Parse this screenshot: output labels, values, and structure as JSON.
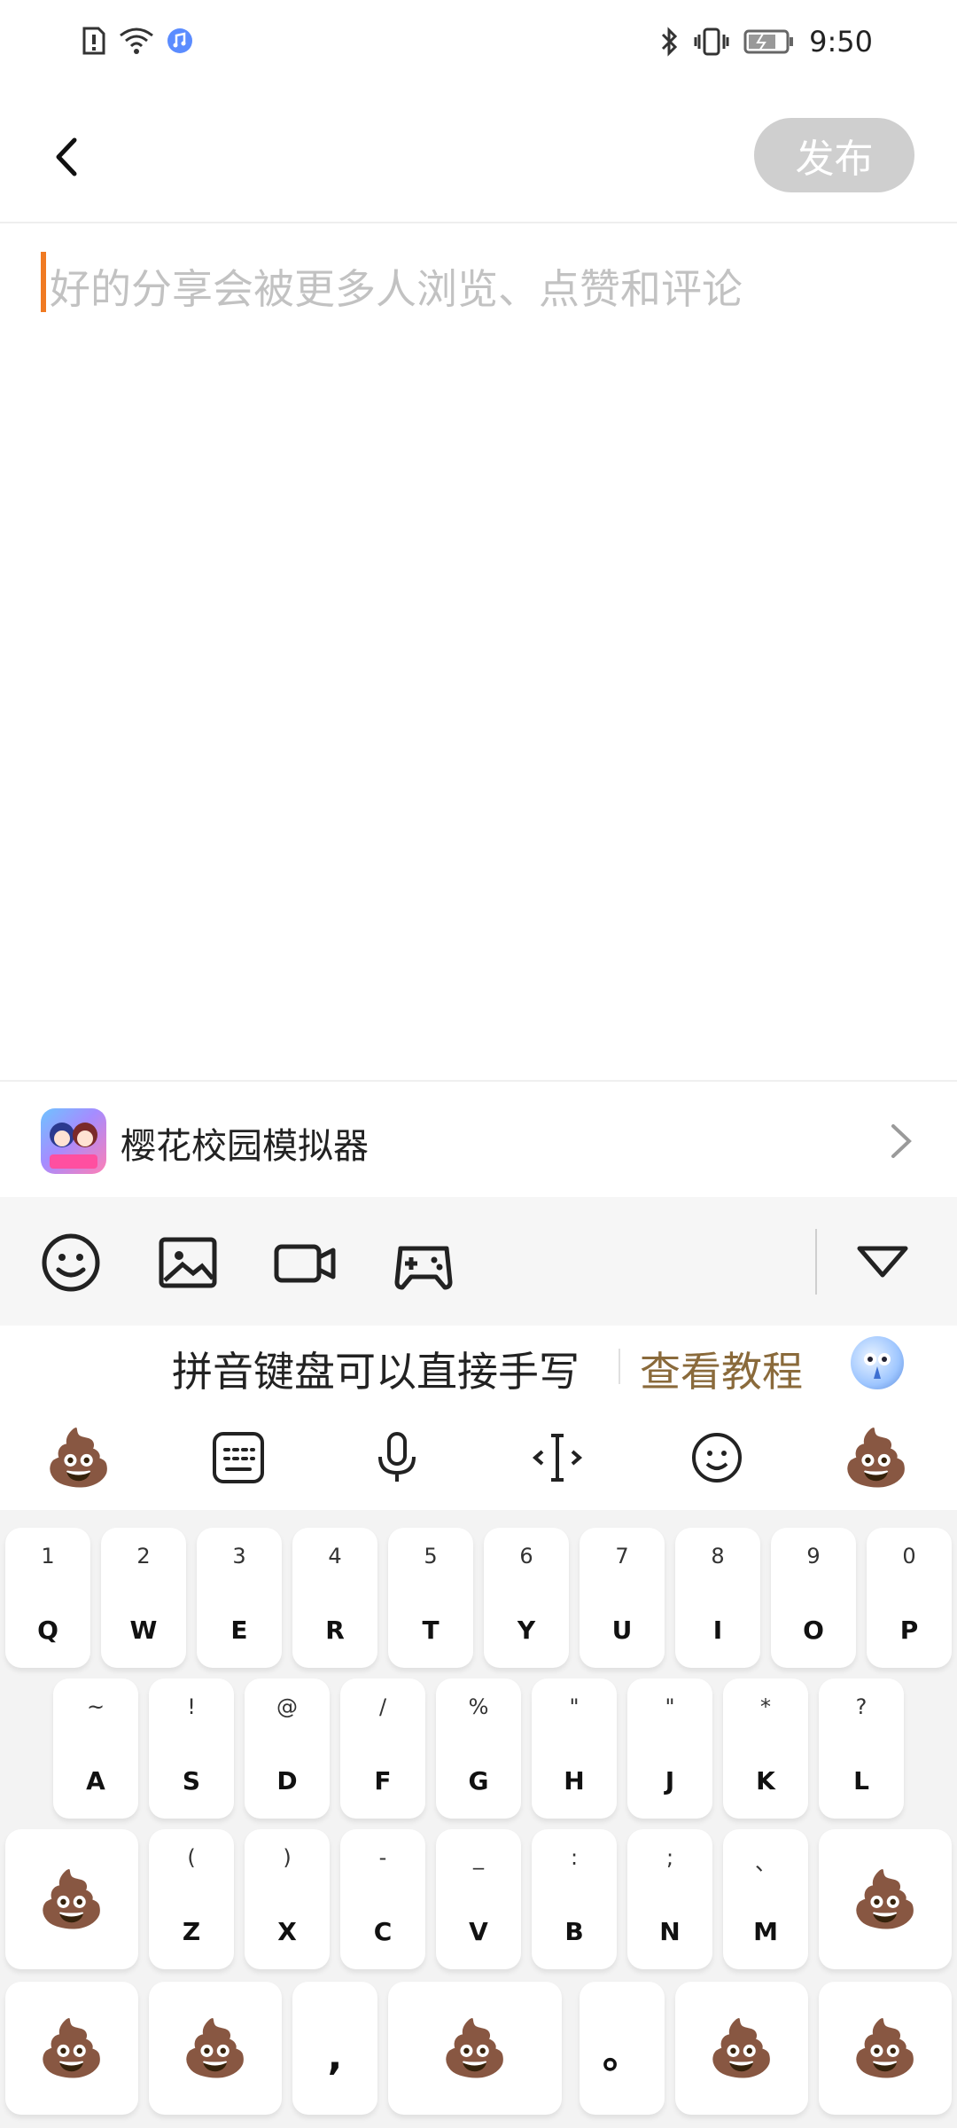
{
  "status_bar": {
    "time": "9:50",
    "left_icons": [
      "sim-alert-icon",
      "wifi-icon",
      "music-app-icon"
    ],
    "right_icons": [
      "bluetooth-icon",
      "vibrate-icon",
      "battery-icon"
    ]
  },
  "topbar": {
    "publish_label": "发布"
  },
  "editor": {
    "placeholder": "好的分享会被更多人浏览、点赞和评论"
  },
  "game": {
    "name": "樱花校园模拟器"
  },
  "toolbar": {
    "tools": [
      "emoji-icon",
      "image-icon",
      "video-icon",
      "gamepad-icon"
    ],
    "collapse_icon": "triangle-down-icon"
  },
  "keyboard": {
    "hint_text": "拼音键盘可以直接手写",
    "hint_link": "查看教程",
    "function_keys": [
      "poop-emoji",
      "keyboard-icon",
      "microphone-icon",
      "cursor-icon",
      "smile-icon",
      "poop-emoji"
    ],
    "row1": [
      {
        "main": "Q",
        "sub": "1"
      },
      {
        "main": "W",
        "sub": "2"
      },
      {
        "main": "E",
        "sub": "3"
      },
      {
        "main": "R",
        "sub": "4"
      },
      {
        "main": "T",
        "sub": "5"
      },
      {
        "main": "Y",
        "sub": "6"
      },
      {
        "main": "U",
        "sub": "7"
      },
      {
        "main": "I",
        "sub": "8"
      },
      {
        "main": "O",
        "sub": "9"
      },
      {
        "main": "P",
        "sub": "0"
      }
    ],
    "row2": [
      {
        "main": "A",
        "sub": "~"
      },
      {
        "main": "S",
        "sub": "!"
      },
      {
        "main": "D",
        "sub": "@"
      },
      {
        "main": "F",
        "sub": "/"
      },
      {
        "main": "G",
        "sub": "%"
      },
      {
        "main": "H",
        "sub": "\""
      },
      {
        "main": "J",
        "sub": "\""
      },
      {
        "main": "K",
        "sub": "*"
      },
      {
        "main": "L",
        "sub": "?"
      }
    ],
    "row3": [
      {
        "main": "Z",
        "sub": "("
      },
      {
        "main": "X",
        "sub": ")"
      },
      {
        "main": "C",
        "sub": "-"
      },
      {
        "main": "V",
        "sub": "_"
      },
      {
        "main": "B",
        "sub": ":"
      },
      {
        "main": "N",
        "sub": ";"
      },
      {
        "main": "M",
        "sub": "、"
      }
    ],
    "row4": {
      "comma": ",",
      "period": "。"
    }
  }
}
